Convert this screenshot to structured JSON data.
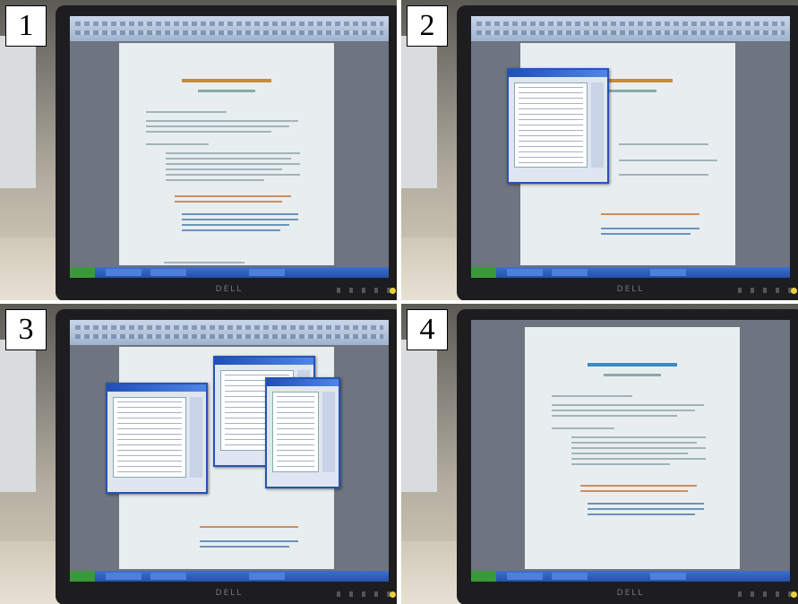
{
  "panels": [
    {
      "label": "1"
    },
    {
      "label": "2"
    },
    {
      "label": "3"
    },
    {
      "label": "4"
    }
  ],
  "monitor": {
    "brand": "DELL"
  }
}
